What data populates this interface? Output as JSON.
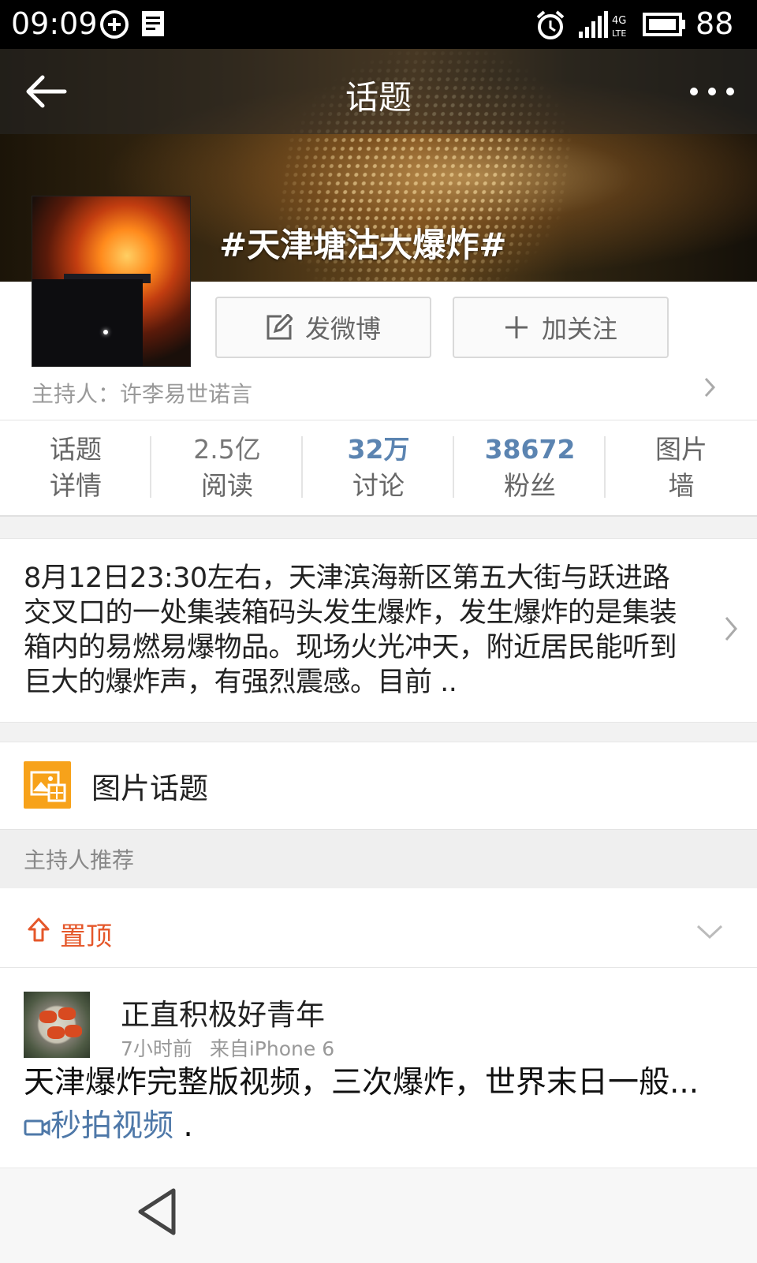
{
  "status_bar": {
    "time": "09:09",
    "battery": "88",
    "network": "4G LTE"
  },
  "header": {
    "title": "话题",
    "topic_name": "#天津塘沽大爆炸#"
  },
  "actions": {
    "post_label": "发微博",
    "follow_label": "加关注"
  },
  "host": {
    "label": "主持人：许李易世诺言"
  },
  "stats": [
    {
      "line1": "话题",
      "line2": "详情"
    },
    {
      "line1": "2.5亿",
      "line2": "阅读"
    },
    {
      "line1": "32万",
      "line2": "讨论"
    },
    {
      "line1": "38672",
      "line2": "粉丝"
    },
    {
      "line1": "图片",
      "line2": "墙"
    }
  ],
  "summary": {
    "text": "8月12日23:30左右，天津滨海新区第五大街与跃进路交叉口的一处集装箱码头发生爆炸，发生爆炸的是集装箱内的易燃易爆物品。现场火光冲天，附近居民能听到巨大的爆炸声，有强烈震感。目前 .."
  },
  "picture_topic": {
    "label": "图片话题"
  },
  "recommend": {
    "label": "主持人推荐"
  },
  "pinned": {
    "label": "置顶"
  },
  "post": {
    "username": "正直积极好青年",
    "time": "7小时前",
    "source": "来自iPhone 6",
    "text": "天津爆炸完整版视频，三次爆炸，世界末日一般...",
    "link": "秒拍视频",
    "trail": " ."
  },
  "colors": {
    "link": "#5b84b1",
    "accent_orange": "#f7a21a",
    "pin_red": "#e5572a"
  }
}
